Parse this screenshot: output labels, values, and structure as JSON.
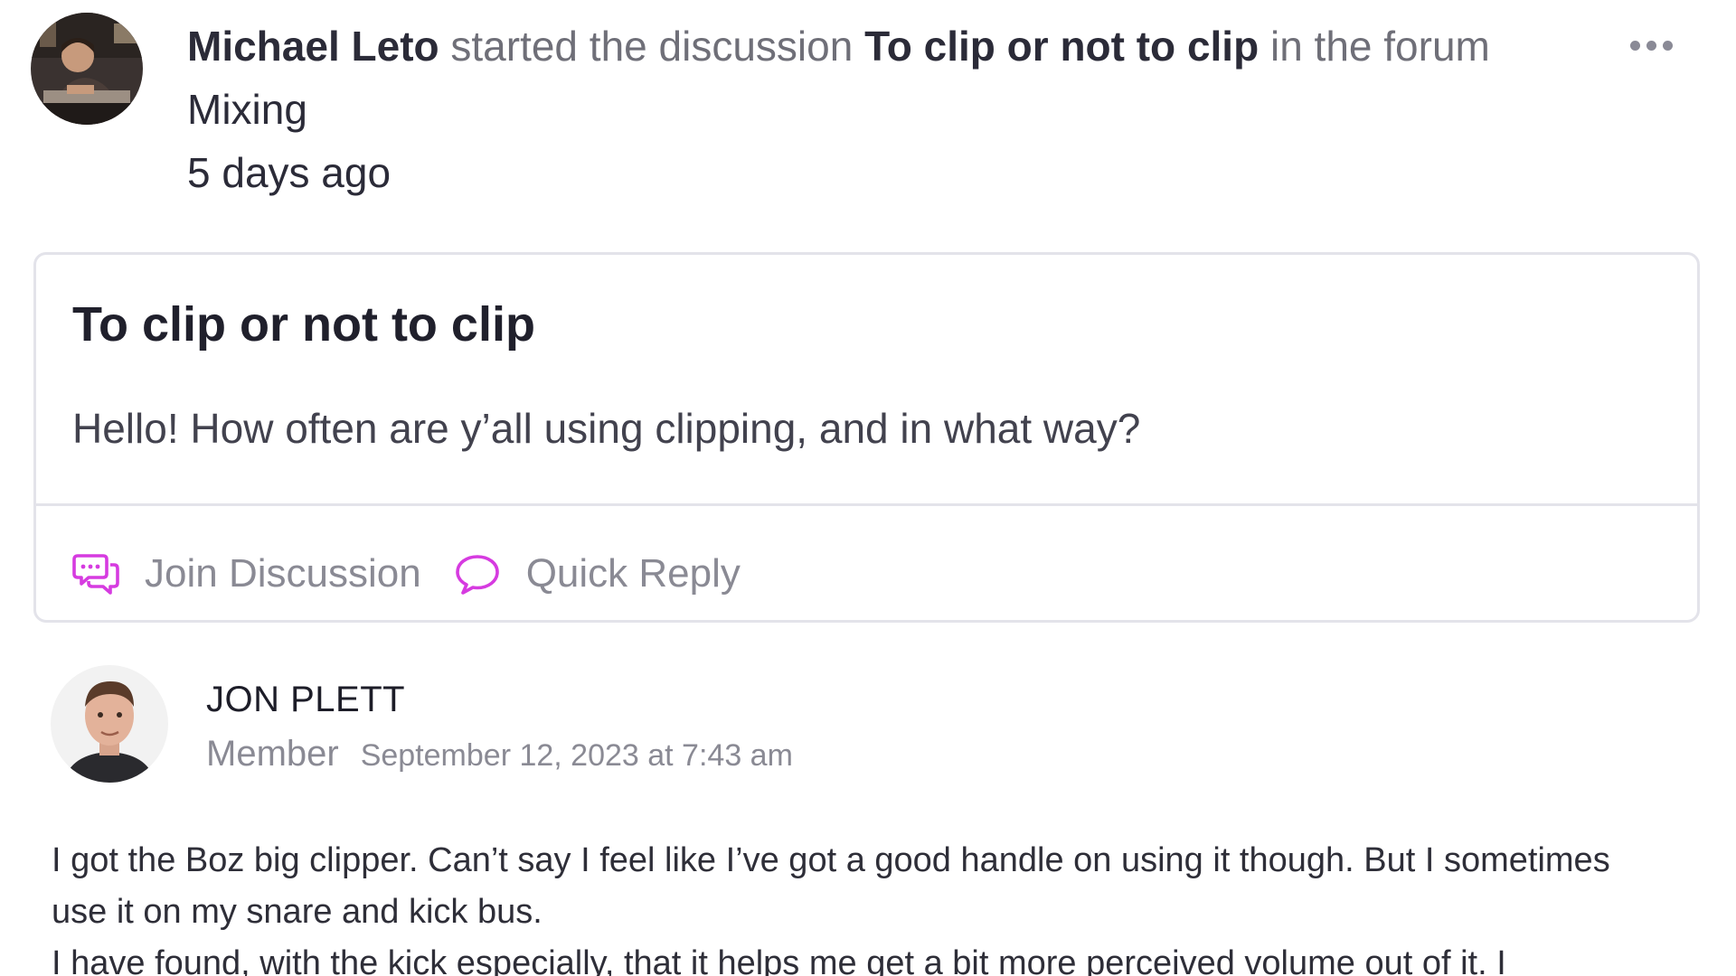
{
  "activity": {
    "author": "Michael Leto",
    "action_text": "started the discussion",
    "discussion_title": "To clip or not to clip",
    "forum_prefix": "in the forum",
    "forum_name": "Mixing",
    "time_ago": "5 days ago",
    "avatar_icon": "user-avatar-photo",
    "more_icon": "ellipsis-icon"
  },
  "card": {
    "title": "To clip or not to clip",
    "body": "Hello! How often are y’all using clipping, and in what way?",
    "actions": {
      "join_label": "Join Discussion",
      "join_icon": "chat-bubbles-icon",
      "quick_reply_label": "Quick Reply",
      "quick_reply_icon": "speech-bubble-icon"
    }
  },
  "reply": {
    "author": "JON PLETT",
    "role": "Member",
    "date": "September 12, 2023 at 7:43 am",
    "avatar_icon": "user-avatar-photo",
    "paragraphs": [
      "I got the Boz big clipper. Can’t say I feel like I’ve got a good handle on using it though. But I sometimes use it on my snare and kick bus.",
      "I have found, with the kick especially, that it helps me get a bit more perceived volume out of it. I"
    ]
  },
  "colors": {
    "accent": "#d63be0",
    "border": "#e3e3ea",
    "muted_text": "#8a8a94",
    "strong_text": "#2b2b38"
  }
}
